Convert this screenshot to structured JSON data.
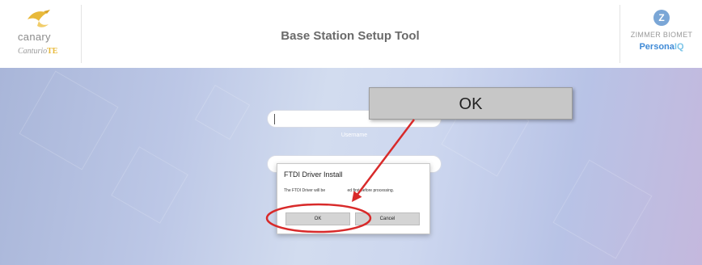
{
  "header": {
    "left_brand": {
      "name": "canary",
      "sub_prefix": "Canturio",
      "sub_suffix": "TE"
    },
    "title": "Base Station Setup Tool",
    "right_brand": {
      "company": "ZIMMER BIOMET",
      "product_prefix": "Persona",
      "product_suffix": "IQ"
    }
  },
  "login": {
    "username_label": "Username"
  },
  "dialog": {
    "title": "FTDI Driver Install",
    "message_start": "The FTDI Driver will be ",
    "message_end": "ed first before processing.",
    "ok_label": "OK",
    "cancel_label": "Cancel"
  },
  "annotation": {
    "callout_text": "OK",
    "highlight_color": "#d82a2a"
  },
  "colors": {
    "canary_accent": "#e8b93a",
    "product_blue": "#3f8ad6"
  }
}
